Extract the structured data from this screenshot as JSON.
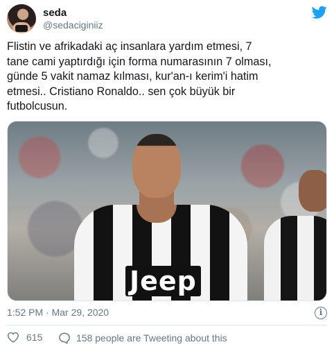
{
  "user": {
    "name": "seda",
    "handle": "@sedaciginiiz"
  },
  "tweet": {
    "text": "Flistin ve afrikadaki aç insanlara yardım etmesi, 7\ntane cami yaptırdığı için forma numarasının 7 olması,\ngünde 5 vakit namaz kılması, kur'an-ı kerim'i hatim\netmesi.. Cristiano Ronaldo.. sen çok büyük bir\nfutbolcusun."
  },
  "media": {
    "sponsor_text": "Jeep"
  },
  "meta": {
    "timestamp": "1:52 PM · Mar 29, 2020",
    "info_glyph": "i"
  },
  "actions": {
    "like_count": "615",
    "people_text": "158 people are Tweeting about this"
  },
  "icons": {
    "twitter": "twitter-bird-icon",
    "heart": "heart-icon",
    "bubble": "speech-bubble-icon",
    "info": "info-icon"
  },
  "colors": {
    "twitter_blue": "#1da1f2",
    "secondary_text": "#657786",
    "divider": "#e1e8ed"
  }
}
